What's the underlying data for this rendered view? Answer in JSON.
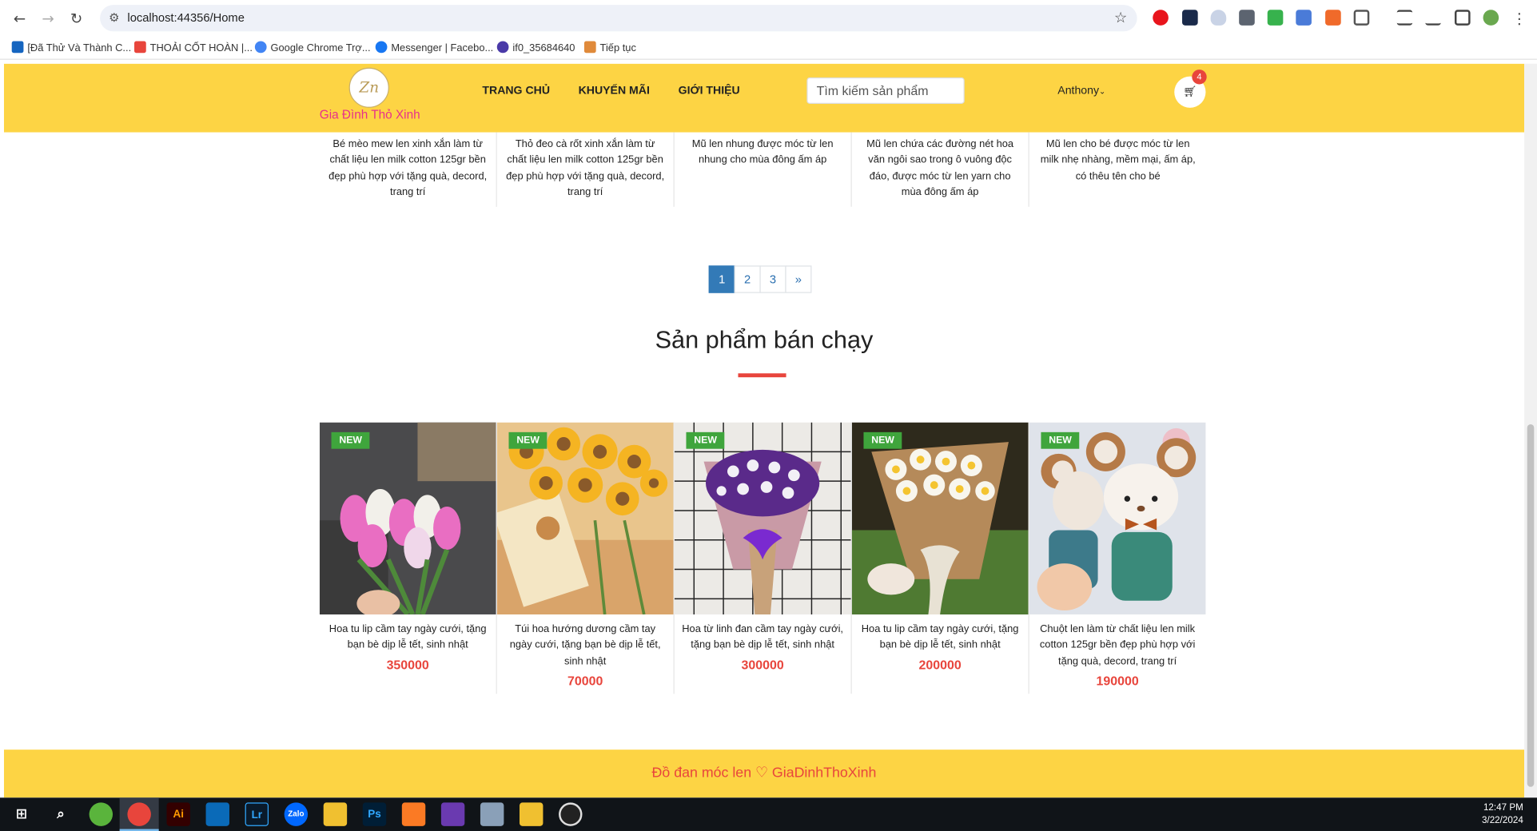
{
  "browser": {
    "url": "localhost:44356/Home",
    "bookmarks": [
      {
        "label": "[Đã Thử Và Thành C...",
        "color": "#1565c0"
      },
      {
        "label": "THOẢI CỐT HOÀN |...",
        "color": "#e8453c"
      },
      {
        "label": "Google Chrome Trợ...",
        "color": "#4285f4"
      },
      {
        "label": "Messenger | Facebo...",
        "color": "#1877f2"
      },
      {
        "label": "if0_35684640",
        "color": "#4a3aa8"
      },
      {
        "label": "Tiếp tục",
        "color": "#e08a3a"
      }
    ]
  },
  "header": {
    "logo_mark": "Zn",
    "logo_text": "Gia Đình Thỏ Xinh",
    "menu": [
      "TRANG CHỦ",
      "KHUYẾN MÃI",
      "GIỚI THIỆU"
    ],
    "search_placeholder": "Tìm kiếm sản phẩm",
    "user": "Anthony",
    "cart_count": "4",
    "colors": {
      "bar": "#fdd444",
      "logo_text": "#e8308a"
    }
  },
  "top_products": [
    "Bé mèo mew len xinh xắn làm từ chất liệu len milk cotton 125gr bền đẹp phù hợp với tặng quà, decord, trang trí",
    "Thỏ đeo cà rốt xinh xắn làm từ chất liệu len milk cotton 125gr bền đẹp phù hợp với tặng quà, decord, trang trí",
    "Mũ len nhung được móc từ len nhung cho mùa đông ấm áp",
    "Mũ len chứa các đường nét hoa văn ngôi sao trong ô vuông độc đáo, được móc từ len yarn cho mùa đông ấm áp",
    "Mũ len cho bé được móc từ len milk nhẹ nhàng, mềm mại, ấm áp, có thêu tên cho bé"
  ],
  "pagination": {
    "pages": [
      "1",
      "2",
      "3"
    ],
    "next": "»",
    "active": "1"
  },
  "bestsellers": {
    "title": "Sản phẩm bán chạy",
    "badge": "NEW",
    "products": [
      {
        "name": "Hoa tu lip cầm tay ngày cưới, tặng bạn bè dịp lễ tết, sinh nhật",
        "price": "350000"
      },
      {
        "name": "Túi hoa hướng dương cầm tay ngày cưới, tặng bạn bè dịp lễ tết, sinh nhật",
        "price": "70000"
      },
      {
        "name": "Hoa từ linh đan cầm tay ngày cưới, tặng bạn bè dịp lễ tết, sinh nhật",
        "price": "300000"
      },
      {
        "name": "Hoa tu lip cầm tay ngày cưới, tặng bạn bè dịp lễ tết, sinh nhật",
        "price": "200000"
      },
      {
        "name": "Chuột len làm từ chất liệu len milk cotton 125gr bền đẹp phù hợp với tặng quà, decord, trang trí",
        "price": "190000"
      }
    ],
    "colors": {
      "price": "#e8453c",
      "badge": "#3fa53c",
      "underline": "#e8453c"
    }
  },
  "footer": {
    "text": "Đồ đan móc len ♡ GiaDinhThoXinh"
  },
  "taskbar": {
    "apps": [
      "start",
      "search",
      "edge-dev",
      "chrome",
      "illustrator",
      "vscode",
      "lightroom",
      "zalo",
      "explorer",
      "photoshop",
      "xampp",
      "visual-studio",
      "rdp",
      "blend",
      "obs"
    ],
    "time": "12:47 PM",
    "date": "3/22/2024"
  }
}
